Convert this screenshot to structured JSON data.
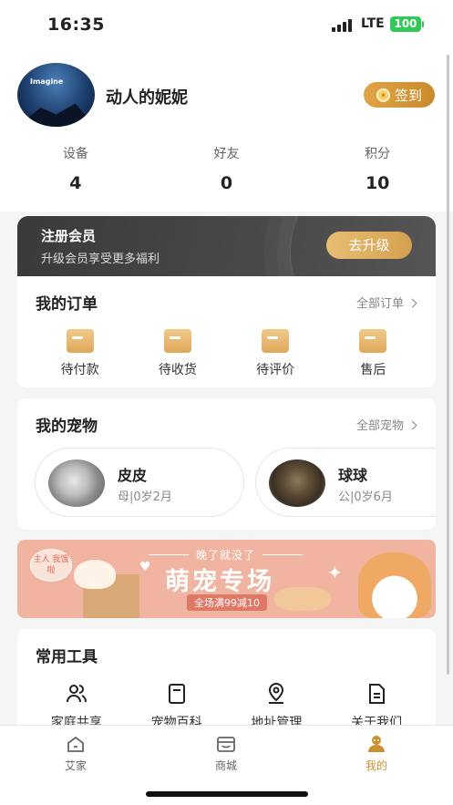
{
  "status_bar": {
    "time": "16:35",
    "network": "LTE",
    "battery": "100"
  },
  "profile": {
    "username": "动人的妮妮",
    "avatar_brand": "Imagine",
    "sign_in_label": "签到"
  },
  "stats": [
    {
      "label": "设备",
      "value": "4"
    },
    {
      "label": "好友",
      "value": "0"
    },
    {
      "label": "积分",
      "value": "10"
    }
  ],
  "vip": {
    "title": "注册会员",
    "subtitle": "升级会员享受更多福利",
    "button": "去升级"
  },
  "orders": {
    "title": "我的订单",
    "more": "全部订单",
    "items": [
      {
        "label": "待付款",
        "icon": "wallet-icon"
      },
      {
        "label": "待收货",
        "icon": "truck-box-icon"
      },
      {
        "label": "待评价",
        "icon": "review-icon"
      },
      {
        "label": "售后",
        "icon": "after-sales-icon"
      }
    ]
  },
  "pets": {
    "title": "我的宠物",
    "more": "全部宠物",
    "items": [
      {
        "name": "皮皮",
        "info": "母|0岁2月"
      },
      {
        "name": "球球",
        "info": "公|0岁6月"
      }
    ]
  },
  "banner": {
    "bubble": "主人 我饿啦",
    "top_text": "晚了就没了",
    "headline": "萌宠专场",
    "promo": "全场满99减10"
  },
  "tools": {
    "title": "常用工具",
    "items": [
      {
        "label": "家庭共享",
        "icon": "family-share-icon"
      },
      {
        "label": "宠物百科",
        "icon": "pet-encyclopedia-icon"
      },
      {
        "label": "地址管理",
        "icon": "location-pin-icon"
      },
      {
        "label": "关于我们",
        "icon": "document-icon"
      }
    ]
  },
  "tabbar": [
    {
      "label": "艾家",
      "icon": "home-icon",
      "active": false
    },
    {
      "label": "商城",
      "icon": "store-icon",
      "active": false
    },
    {
      "label": "我的",
      "icon": "profile-icon",
      "active": true
    }
  ],
  "colors": {
    "accent": "#c9902e",
    "vip_bg": "#3d3d3d",
    "banner_bg": "#f0b4a0"
  }
}
